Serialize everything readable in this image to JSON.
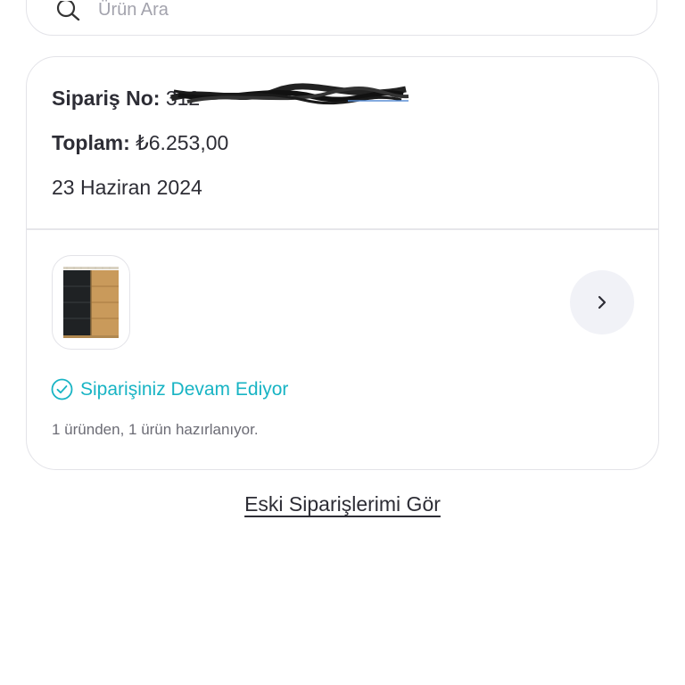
{
  "search": {
    "placeholder": "Ürün Ara"
  },
  "order": {
    "number_label": "Sipariş No:",
    "number_value": "312",
    "total_label": "Toplam:",
    "total_value": "₺6.253,00",
    "date": "23 Haziran 2024",
    "status": "Siparişiniz Devam Ediyor",
    "status_detail": "1 üründen, 1 ürün hazırlanıyor."
  },
  "footer": {
    "old_orders_link": "Eski Siparişlerimi Gör"
  },
  "colors": {
    "status_accent": "#18b4c4",
    "text": "#2d2d35",
    "next_button_bg": "#f1f2f7"
  },
  "icons": {
    "search": "search-icon",
    "next": "chevron-right-icon",
    "status": "check-circle-icon"
  }
}
